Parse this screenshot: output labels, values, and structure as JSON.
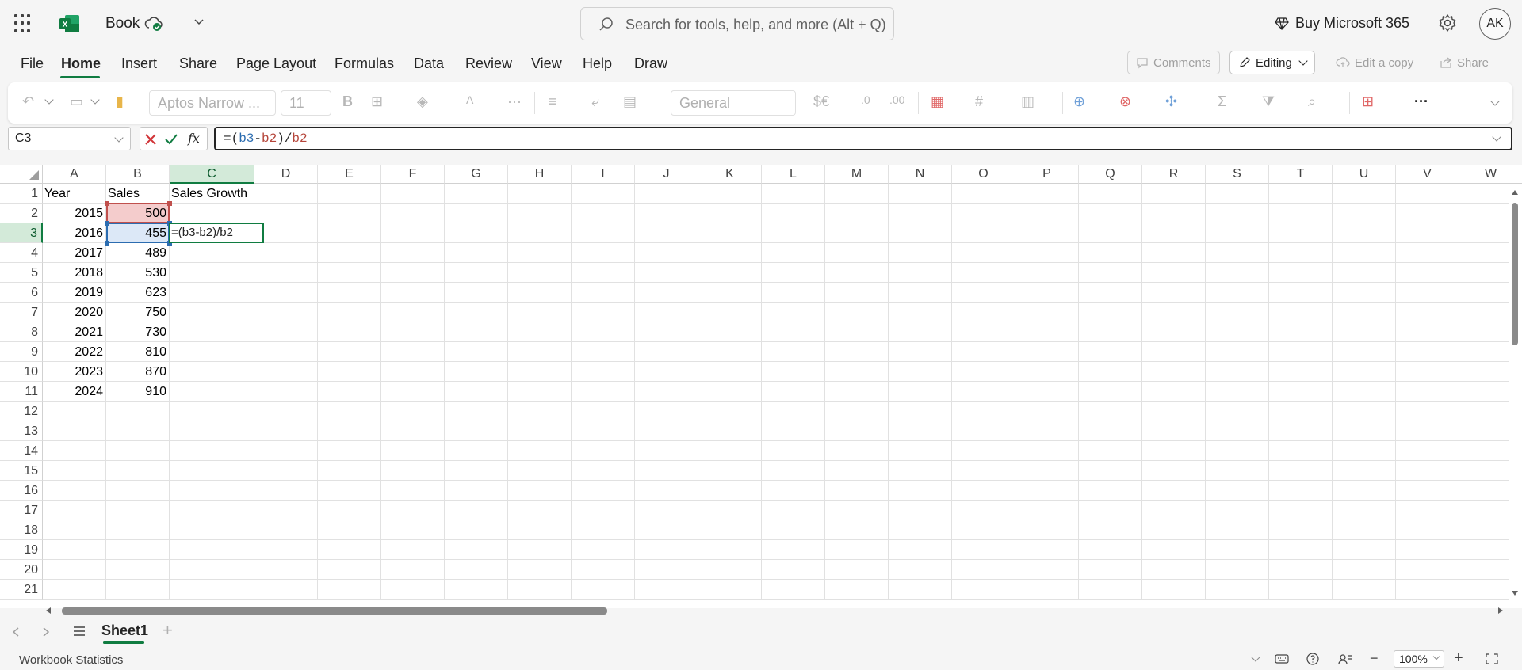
{
  "titlebar": {
    "app_icon": "excel-logo-icon",
    "doc_title": "Book",
    "search_placeholder": "Search for tools, help, and more (Alt + Q)",
    "buy_label": "Buy Microsoft 365",
    "avatar_initials": "AK"
  },
  "menu": {
    "tabs": [
      "File",
      "Home",
      "Insert",
      "Share",
      "Page Layout",
      "Formulas",
      "Data",
      "Review",
      "View",
      "Help",
      "Draw"
    ],
    "active_tab": "Home",
    "comments_label": "Comments",
    "editing_label": "Editing",
    "edit_copy_label": "Edit a copy",
    "share_label": "Share"
  },
  "ribbon": {
    "font_name": "Aptos Narrow ...",
    "font_size": "11",
    "number_format": "General",
    "currency_label": "$€",
    "bold_label": "B",
    "font_color_label": "A"
  },
  "formula_bar": {
    "name_box": "C3",
    "fx_label": "fx",
    "formula_parts": [
      {
        "text": "=(",
        "color": "#242424"
      },
      {
        "text": "b3",
        "color": "#2b6cb0"
      },
      {
        "text": "-",
        "color": "#242424"
      },
      {
        "text": "b2",
        "color": "#b5453a"
      },
      {
        "text": ")/",
        "color": "#242424"
      },
      {
        "text": "b2",
        "color": "#b5453a"
      }
    ]
  },
  "sheet": {
    "columns": [
      "A",
      "B",
      "C",
      "D",
      "E",
      "F",
      "G",
      "H",
      "I",
      "J",
      "K",
      "L",
      "M",
      "N",
      "O",
      "P",
      "Q",
      "R",
      "S",
      "T",
      "U",
      "V",
      "W"
    ],
    "selected_column": "C",
    "selected_row": 3,
    "row_count": 21,
    "headers": {
      "A1": "Year",
      "B1": "Sales",
      "C1": "Sales Growth"
    },
    "rows": [
      {
        "year": "2015",
        "sales": "500"
      },
      {
        "year": "2016",
        "sales": "455"
      },
      {
        "year": "2017",
        "sales": "489"
      },
      {
        "year": "2018",
        "sales": "530"
      },
      {
        "year": "2019",
        "sales": "623"
      },
      {
        "year": "2020",
        "sales": "750"
      },
      {
        "year": "2021",
        "sales": "730"
      },
      {
        "year": "2022",
        "sales": "810"
      },
      {
        "year": "2023",
        "sales": "870"
      },
      {
        "year": "2024",
        "sales": "910"
      }
    ],
    "active_cell_text": "=(b3-b2)/b2",
    "ref_colors": {
      "b2": "#f4cccc",
      "b2_border": "#c0504d",
      "b3": "#dce8f7",
      "b3_border": "#2b6cb0",
      "active": "#107c41"
    }
  },
  "sheet_tabs": {
    "tabs": [
      "Sheet1"
    ],
    "add_label": "+"
  },
  "status": {
    "left_text": "Workbook Statistics",
    "zoom": "100%"
  }
}
